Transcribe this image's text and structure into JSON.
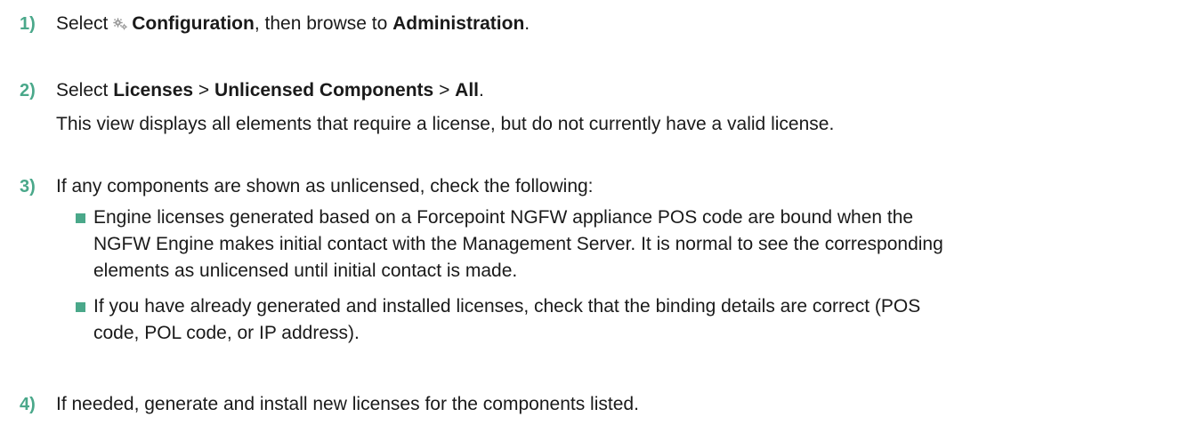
{
  "steps": [
    {
      "number": "1)",
      "parts": {
        "t1": "Select ",
        "icon": "gear-icon",
        "b1": "Configuration",
        "t2": ", then browse to ",
        "b2": "Administration",
        "t3": "."
      }
    },
    {
      "number": "2)",
      "parts": {
        "t1": "Select ",
        "b1": "Licenses",
        "t2": " > ",
        "b2": "Unlicensed Components",
        "t3": " > ",
        "b3": "All",
        "t4": "."
      },
      "note": "This view displays all elements that require a license, but do not currently have a valid license."
    },
    {
      "number": "3)",
      "text": "If any components are shown as unlicensed, check the following:",
      "bullets": [
        {
          "lines": [
            "Engine licenses generated based on a Forcepoint NGFW appliance POS code are bound when the",
            "NGFW Engine makes initial contact with the Management Server. It is normal to see the corresponding",
            "elements as unlicensed until initial contact is made."
          ]
        },
        {
          "lines": [
            "If you have already generated and installed licenses, check that the binding details are correct (POS",
            "code, POL code, or IP address)."
          ]
        }
      ]
    },
    {
      "number": "4)",
      "text": "If needed, generate and install new licenses for the components listed."
    }
  ],
  "colors": {
    "accent": "#4aa88a",
    "text": "#1a1a1a",
    "icon": "#9a9a9a"
  }
}
